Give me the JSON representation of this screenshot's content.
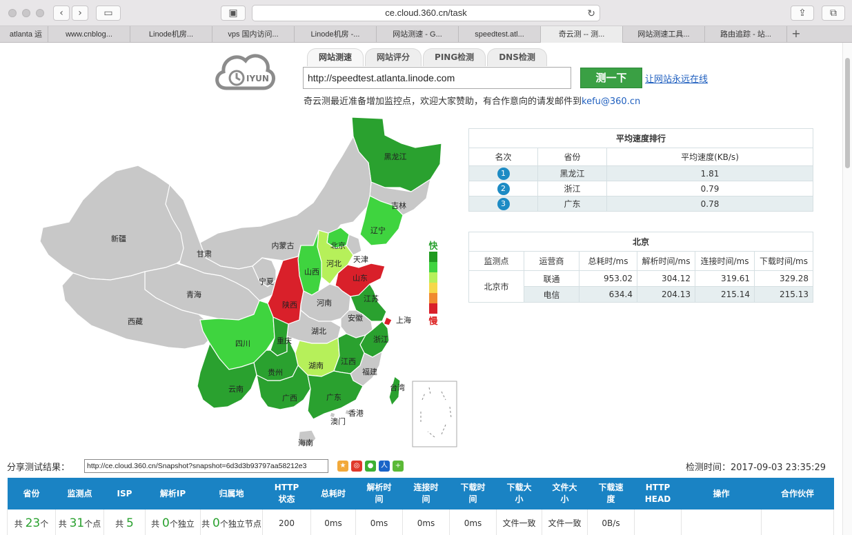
{
  "browser": {
    "url": "ce.cloud.360.cn/task",
    "tabs": [
      "atlanta 运",
      "www.cnblog...",
      "Linode机房...",
      "vps 国内访问...",
      "Linode机房 -...",
      "网站测速 - G...",
      "speedtest.atl...",
      "奇云测 -- 测...",
      "网站测速工具...",
      "路由追踪 - 站..."
    ],
    "active_tab": 7
  },
  "site": {
    "logo_text": "IYUN",
    "tabs": [
      "网站测速",
      "网站评分",
      "PING检测",
      "DNS检测"
    ],
    "input_value": "http://speedtest.atlanta.linode.com",
    "go_button": "测一下",
    "online_link": "让网站永远在线",
    "notice": "奇云测最近准备增加监控点，欢迎大家赞助，有合作意向的请发邮件到",
    "notice_email": "kefu@360.cn"
  },
  "legend": {
    "fast": "快",
    "slow": "慢",
    "colors": [
      "#1f9a1f",
      "#3fd43f",
      "#b6f05a",
      "#f5d84a",
      "#f08a30",
      "#d9202a"
    ]
  },
  "map": {
    "provinces": [
      {
        "name": "黑龙江",
        "color": "#2aa12f"
      },
      {
        "name": "吉林",
        "color": "#c8c8c8"
      },
      {
        "name": "辽宁",
        "color": "#3fd43f"
      },
      {
        "name": "内蒙古",
        "color": "#c8c8c8"
      },
      {
        "name": "新疆",
        "color": "#c8c8c8"
      },
      {
        "name": "甘肃",
        "color": "#c8c8c8"
      },
      {
        "name": "宁夏",
        "color": "#c8c8c8"
      },
      {
        "name": "青海",
        "color": "#c8c8c8"
      },
      {
        "name": "西藏",
        "color": "#c8c8c8"
      },
      {
        "name": "北京",
        "color": "#3fd43f"
      },
      {
        "name": "天津",
        "color": "#c8c8c8"
      },
      {
        "name": "河北",
        "color": "#b6f05a"
      },
      {
        "name": "山西",
        "color": "#3fd43f"
      },
      {
        "name": "山东",
        "color": "#d9202a"
      },
      {
        "name": "陕西",
        "color": "#d9202a"
      },
      {
        "name": "河南",
        "color": "#c8c8c8"
      },
      {
        "name": "江苏",
        "color": "#2aa12f"
      },
      {
        "name": "安徽",
        "color": "#c8c8c8"
      },
      {
        "name": "上海",
        "color": "#d9202a"
      },
      {
        "name": "湖北",
        "color": "#c8c8c8"
      },
      {
        "name": "浙江",
        "color": "#2aa12f"
      },
      {
        "name": "四川",
        "color": "#3fd43f"
      },
      {
        "name": "重庆",
        "color": "#2aa12f"
      },
      {
        "name": "湖南",
        "color": "#b6f05a"
      },
      {
        "name": "江西",
        "color": "#2aa12f"
      },
      {
        "name": "贵州",
        "color": "#2aa12f"
      },
      {
        "name": "福建",
        "color": "#c8c8c8"
      },
      {
        "name": "台湾",
        "color": "#2aa12f"
      },
      {
        "name": "云南",
        "color": "#2aa12f"
      },
      {
        "name": "广西",
        "color": "#2aa12f"
      },
      {
        "name": "广东",
        "color": "#2aa12f"
      },
      {
        "name": "香港",
        "color": "#c8c8c8"
      },
      {
        "name": "澳门",
        "color": "#c8c8c8"
      },
      {
        "name": "海南",
        "color": "#c8c8c8"
      }
    ]
  },
  "rank": {
    "title": "平均速度排行",
    "headers": [
      "名次",
      "省份",
      "平均速度(KB/s)"
    ],
    "rows": [
      {
        "rank": "1",
        "province": "黑龙江",
        "speed": "1.81"
      },
      {
        "rank": "2",
        "province": "浙江",
        "speed": "0.79"
      },
      {
        "rank": "3",
        "province": "广东",
        "speed": "0.78"
      }
    ]
  },
  "beijing": {
    "title": "北京",
    "headers": [
      "监测点",
      "运营商",
      "总耗时/ms",
      "解析时间/ms",
      "连接时间/ms",
      "下载时间/ms"
    ],
    "point": "北京市",
    "rows": [
      {
        "isp": "联通",
        "total": "953.02",
        "dns": "304.12",
        "connect": "319.61",
        "download": "329.28"
      },
      {
        "isp": "电信",
        "total": "634.4",
        "dns": "204.13",
        "connect": "215.14",
        "download": "215.13"
      }
    ]
  },
  "share": {
    "label": "分享测试结果：",
    "url": "http://ce.cloud.360.cn/Snapshot?snapshot=6d3d3b93797aa58212e3",
    "time_label": "检测时间：2017-09-03 23:35:29"
  },
  "results": {
    "headers": [
      "省份",
      "监测点",
      "ISP",
      "解析IP",
      "归属地",
      "HTTP\n状态",
      "总耗时",
      "解析时\n间",
      "连接时\n间",
      "下载时\n间",
      "下载大\n小",
      "文件大\n小",
      "下载速\n度",
      "HTTP\nHEAD",
      "操作",
      "合作伙伴"
    ],
    "summary": {
      "prov_pre": "共",
      "prov_num": "23",
      "prov_post": "个",
      "pt_pre": "共",
      "pt_num": "31",
      "pt_post": "个点",
      "isp_pre": "共",
      "isp_num": "5",
      "ip_pre": "共",
      "ip_num": "0",
      "ip_post": "个独立",
      "loc_pre": "共",
      "loc_num": "0",
      "loc_post": "个独立节点",
      "http": "200",
      "total": "0ms",
      "dns": "0ms",
      "connect": "0ms",
      "download": "0ms",
      "dl_size": "文件一致",
      "file_size": "文件一致",
      "speed": "0B/s"
    }
  }
}
